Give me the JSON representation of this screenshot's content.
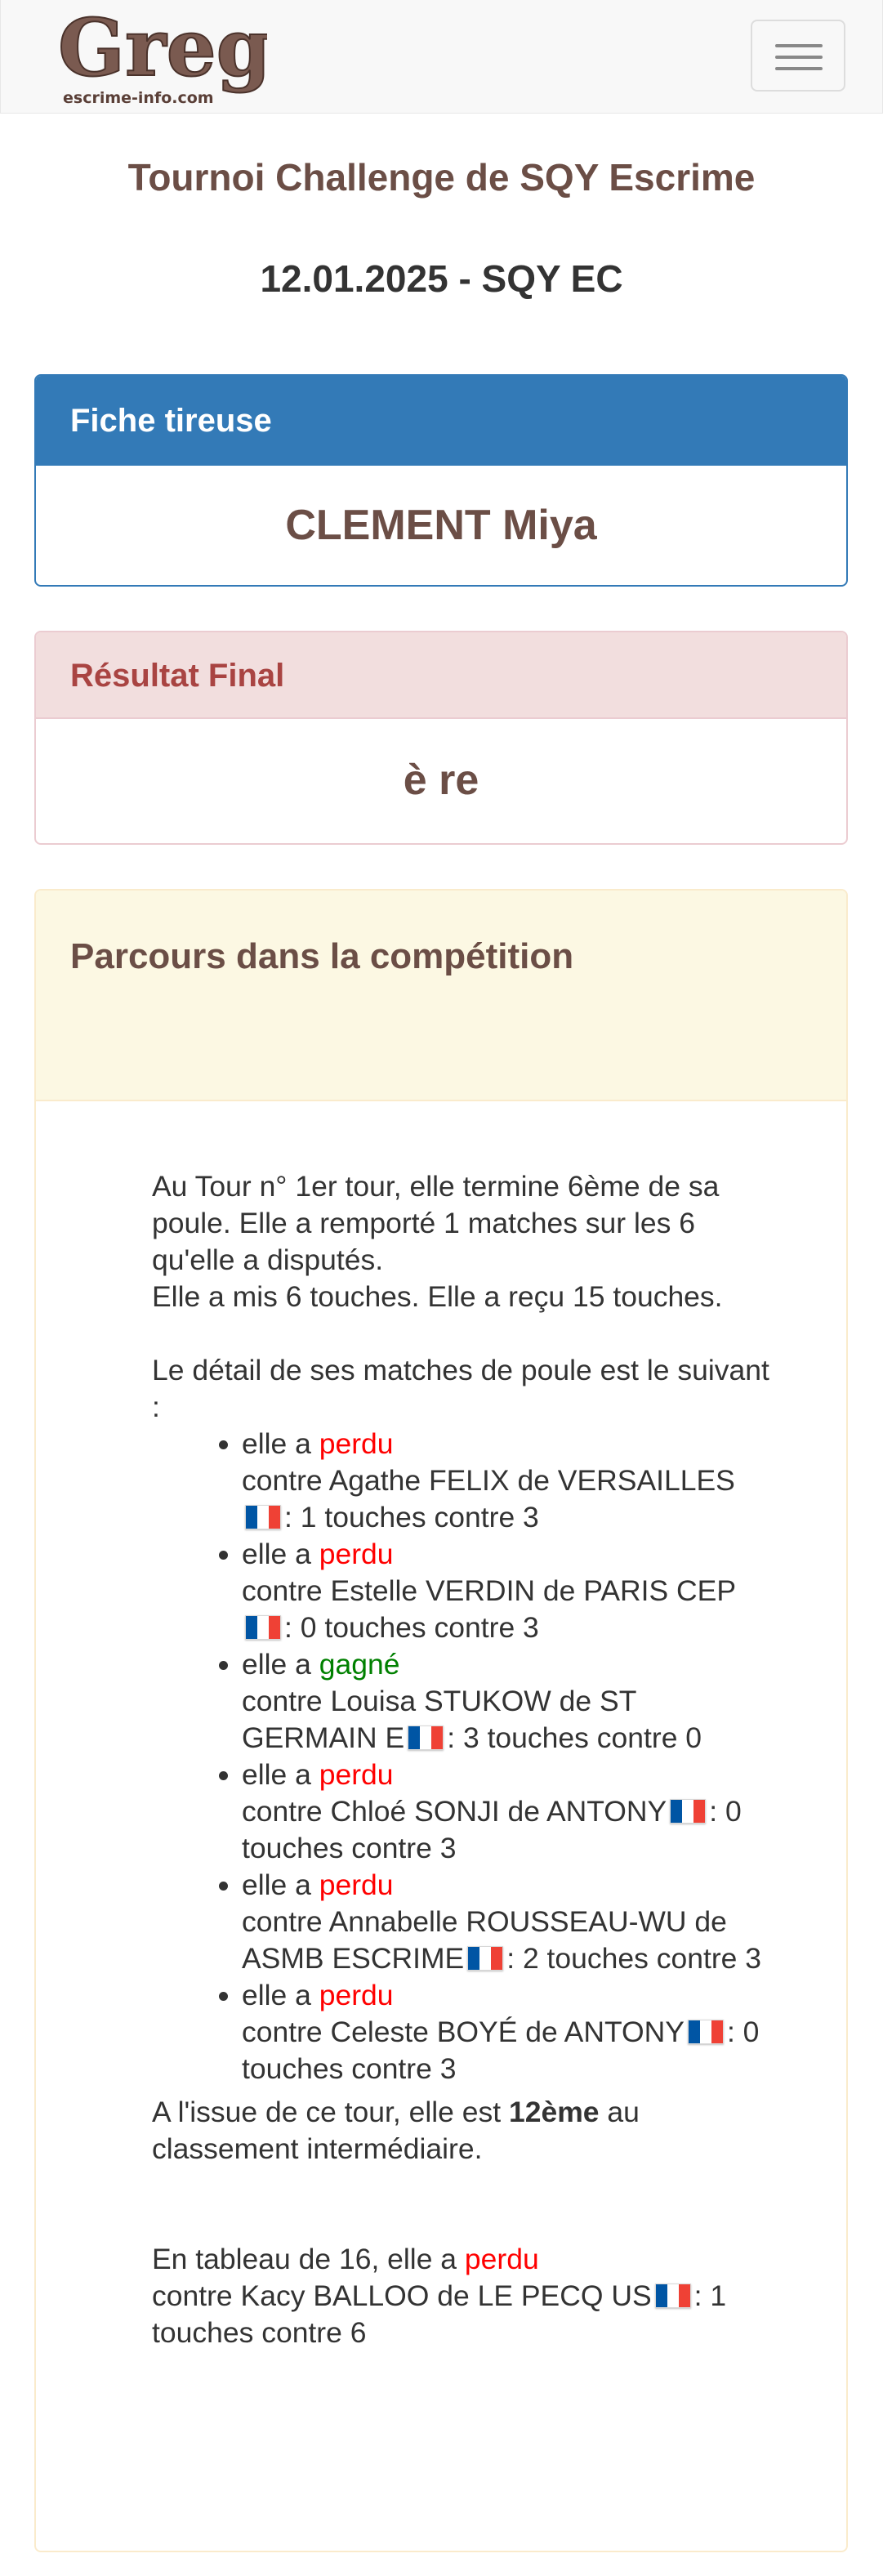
{
  "navbar": {
    "logo_text": "Greg",
    "logo_subtext": "escrime-info.com",
    "menu_icon": "hamburger-menu-icon"
  },
  "page": {
    "title": "Tournoi Challenge de SQY Escrime",
    "subtitle": "12.01.2025 - SQY EC"
  },
  "fiche": {
    "heading": "Fiche tireuse",
    "name": "CLEMENT Miya"
  },
  "resultat": {
    "heading": "Résultat Final",
    "value": "è re"
  },
  "parcours": {
    "heading": "Parcours dans la compétition",
    "intro_1": "Au Tour n° 1er tour, elle termine 6ème de sa poule. Elle a remporté 1 matches sur les 6 qu'elle a disputés.",
    "intro_2": "Elle a mis 6 touches. Elle a reçu 15 touches.",
    "detail_intro": "Le détail de ses matches de poule est le suivant :",
    "matches": [
      {
        "prefix": "elle a ",
        "result": "perdu",
        "won": false,
        "opponent": "contre Agathe FELIX de VERSAILLES",
        "score": ": 1 touches contre 3",
        "flag_icon": "france-flag-icon"
      },
      {
        "prefix": "elle a ",
        "result": "perdu",
        "won": false,
        "opponent": "contre Estelle VERDIN de PARIS CEP",
        "score": ": 0 touches contre 3",
        "flag_icon": "france-flag-icon"
      },
      {
        "prefix": "elle a ",
        "result": "gagné",
        "won": true,
        "opponent": "contre Louisa STUKOW de ST GERMAIN E",
        "score": ": 3 touches contre 0",
        "flag_icon": "france-flag-icon"
      },
      {
        "prefix": "elle a ",
        "result": "perdu",
        "won": false,
        "opponent": "contre Chloé SONJI de ANTONY",
        "score": ": 0 touches contre 3",
        "flag_icon": "france-flag-icon"
      },
      {
        "prefix": "elle a ",
        "result": "perdu",
        "won": false,
        "opponent": "contre Annabelle ROUSSEAU-WU de ASMB ESCRIME",
        "score": ": 2 touches contre 3",
        "flag_icon": "france-flag-icon"
      },
      {
        "prefix": "elle a ",
        "result": "perdu",
        "won": false,
        "opponent": "contre Celeste BOYÉ de ANTONY",
        "score": ": 0 touches contre 3",
        "flag_icon": "france-flag-icon"
      }
    ],
    "ranking_prefix": "A l'issue de ce tour, elle est ",
    "ranking_value": "12ème",
    "ranking_suffix": " au classement intermédiaire.",
    "tableau_prefix": "En tableau de 16, elle a ",
    "tableau_result": "perdu",
    "tableau_opponent": "contre Kacy BALLOO de LE PECQ US",
    "tableau_score": ": 1 touches contre 6",
    "tableau_flag_icon": "france-flag-icon"
  },
  "colors": {
    "primary": "#337ab7",
    "danger_bg": "#f2dede",
    "danger_text": "#a94442",
    "warning_bg": "#fcf8e3",
    "brown_text": "#6b4e46",
    "lost": "#ff0000",
    "won": "#008000"
  }
}
